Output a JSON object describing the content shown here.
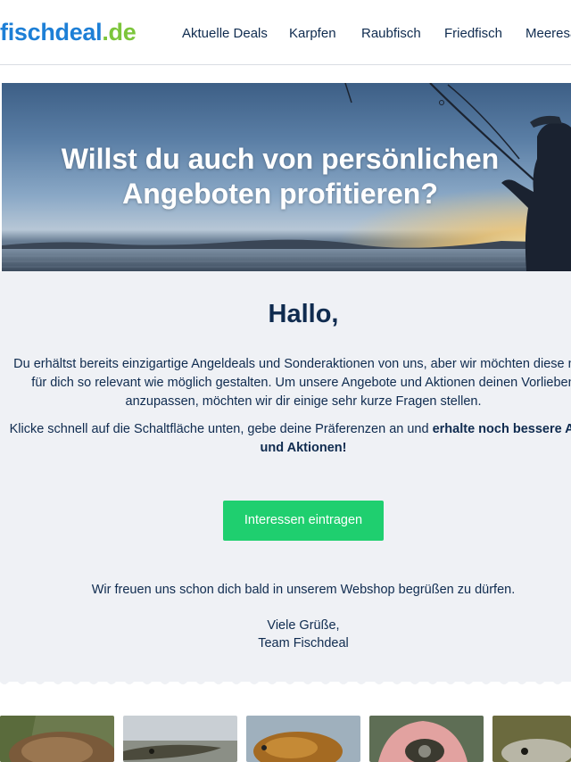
{
  "header": {
    "logo": {
      "part1": "fischdeal",
      "part2": ".de"
    },
    "nav": [
      {
        "label": "Aktuelle Deals"
      },
      {
        "label": "Karpfen"
      },
      {
        "label": "Raubfisch"
      },
      {
        "label": "Friedfisch"
      },
      {
        "label": "Meeresa"
      }
    ]
  },
  "hero": {
    "title_line1": "Willst du auch von persönlichen",
    "title_line2": "Angeboten profitieren?"
  },
  "main": {
    "greeting": "Hallo,",
    "para1_line1": "Du erhältst bereits einzigartige Angeldeals und Sonderaktionen von uns, aber wir möchten diese natü",
    "para1_line2": "für dich so relevant wie möglich gestalten. Um unsere Angebote und Aktionen deinen Vorlieben",
    "para1_line3": "anzupassen, möchten wir dir einige sehr kurze Fragen stellen.",
    "para2_prefix": "Klicke schnell auf die Schaltfläche unten, gebe deine Präferenzen an und ",
    "para2_bold1": "erhalte noch bessere Ange",
    "para2_bold2": "und Aktionen!",
    "cta_label": "Interessen eintragen",
    "closing": "Wir freuen uns schon dich bald in unserem Webshop begrüßen zu dürfen.",
    "signoff_line1": "Viele Grüße,",
    "signoff_line2": "Team Fischdeal"
  },
  "colors": {
    "brand_blue": "#1d7fd6",
    "brand_green": "#7cc53b",
    "cta_green": "#1fcf6f",
    "text_navy": "#0f2b4f",
    "content_bg": "#eff1f5"
  },
  "thumbnails": [
    {
      "icon": "carp-photo"
    },
    {
      "icon": "pike-photo"
    },
    {
      "icon": "tench-photo"
    },
    {
      "icon": "hand-fish-photo"
    },
    {
      "icon": "fish-photo"
    }
  ]
}
